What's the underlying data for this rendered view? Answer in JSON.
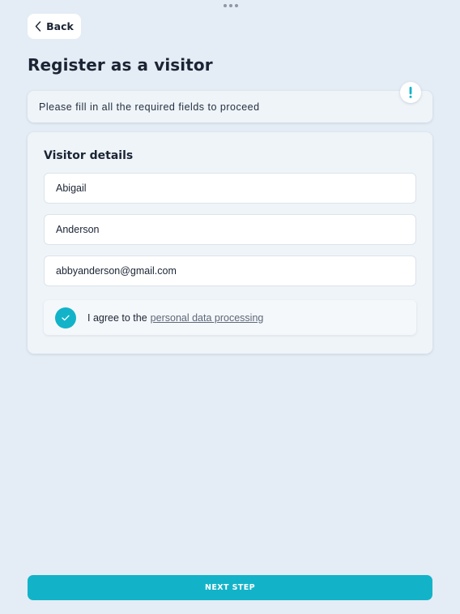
{
  "header": {
    "back_label": "Back",
    "title": "Register as a visitor"
  },
  "notice": {
    "text": "Please fill in all the required fields to proceed",
    "icon": "exclamation-icon"
  },
  "visitor_details": {
    "title": "Visitor details",
    "first_name": "Abigail",
    "last_name": "Anderson",
    "email": "abbyanderson@gmail.com"
  },
  "consent": {
    "checked": true,
    "prefix": "I agree to the",
    "link_text": "personal data processing"
  },
  "footer": {
    "next_label": "NEXT STEP"
  },
  "colors": {
    "background": "#e4ecf5",
    "accent": "#12b3c9",
    "text": "#1b2434"
  }
}
